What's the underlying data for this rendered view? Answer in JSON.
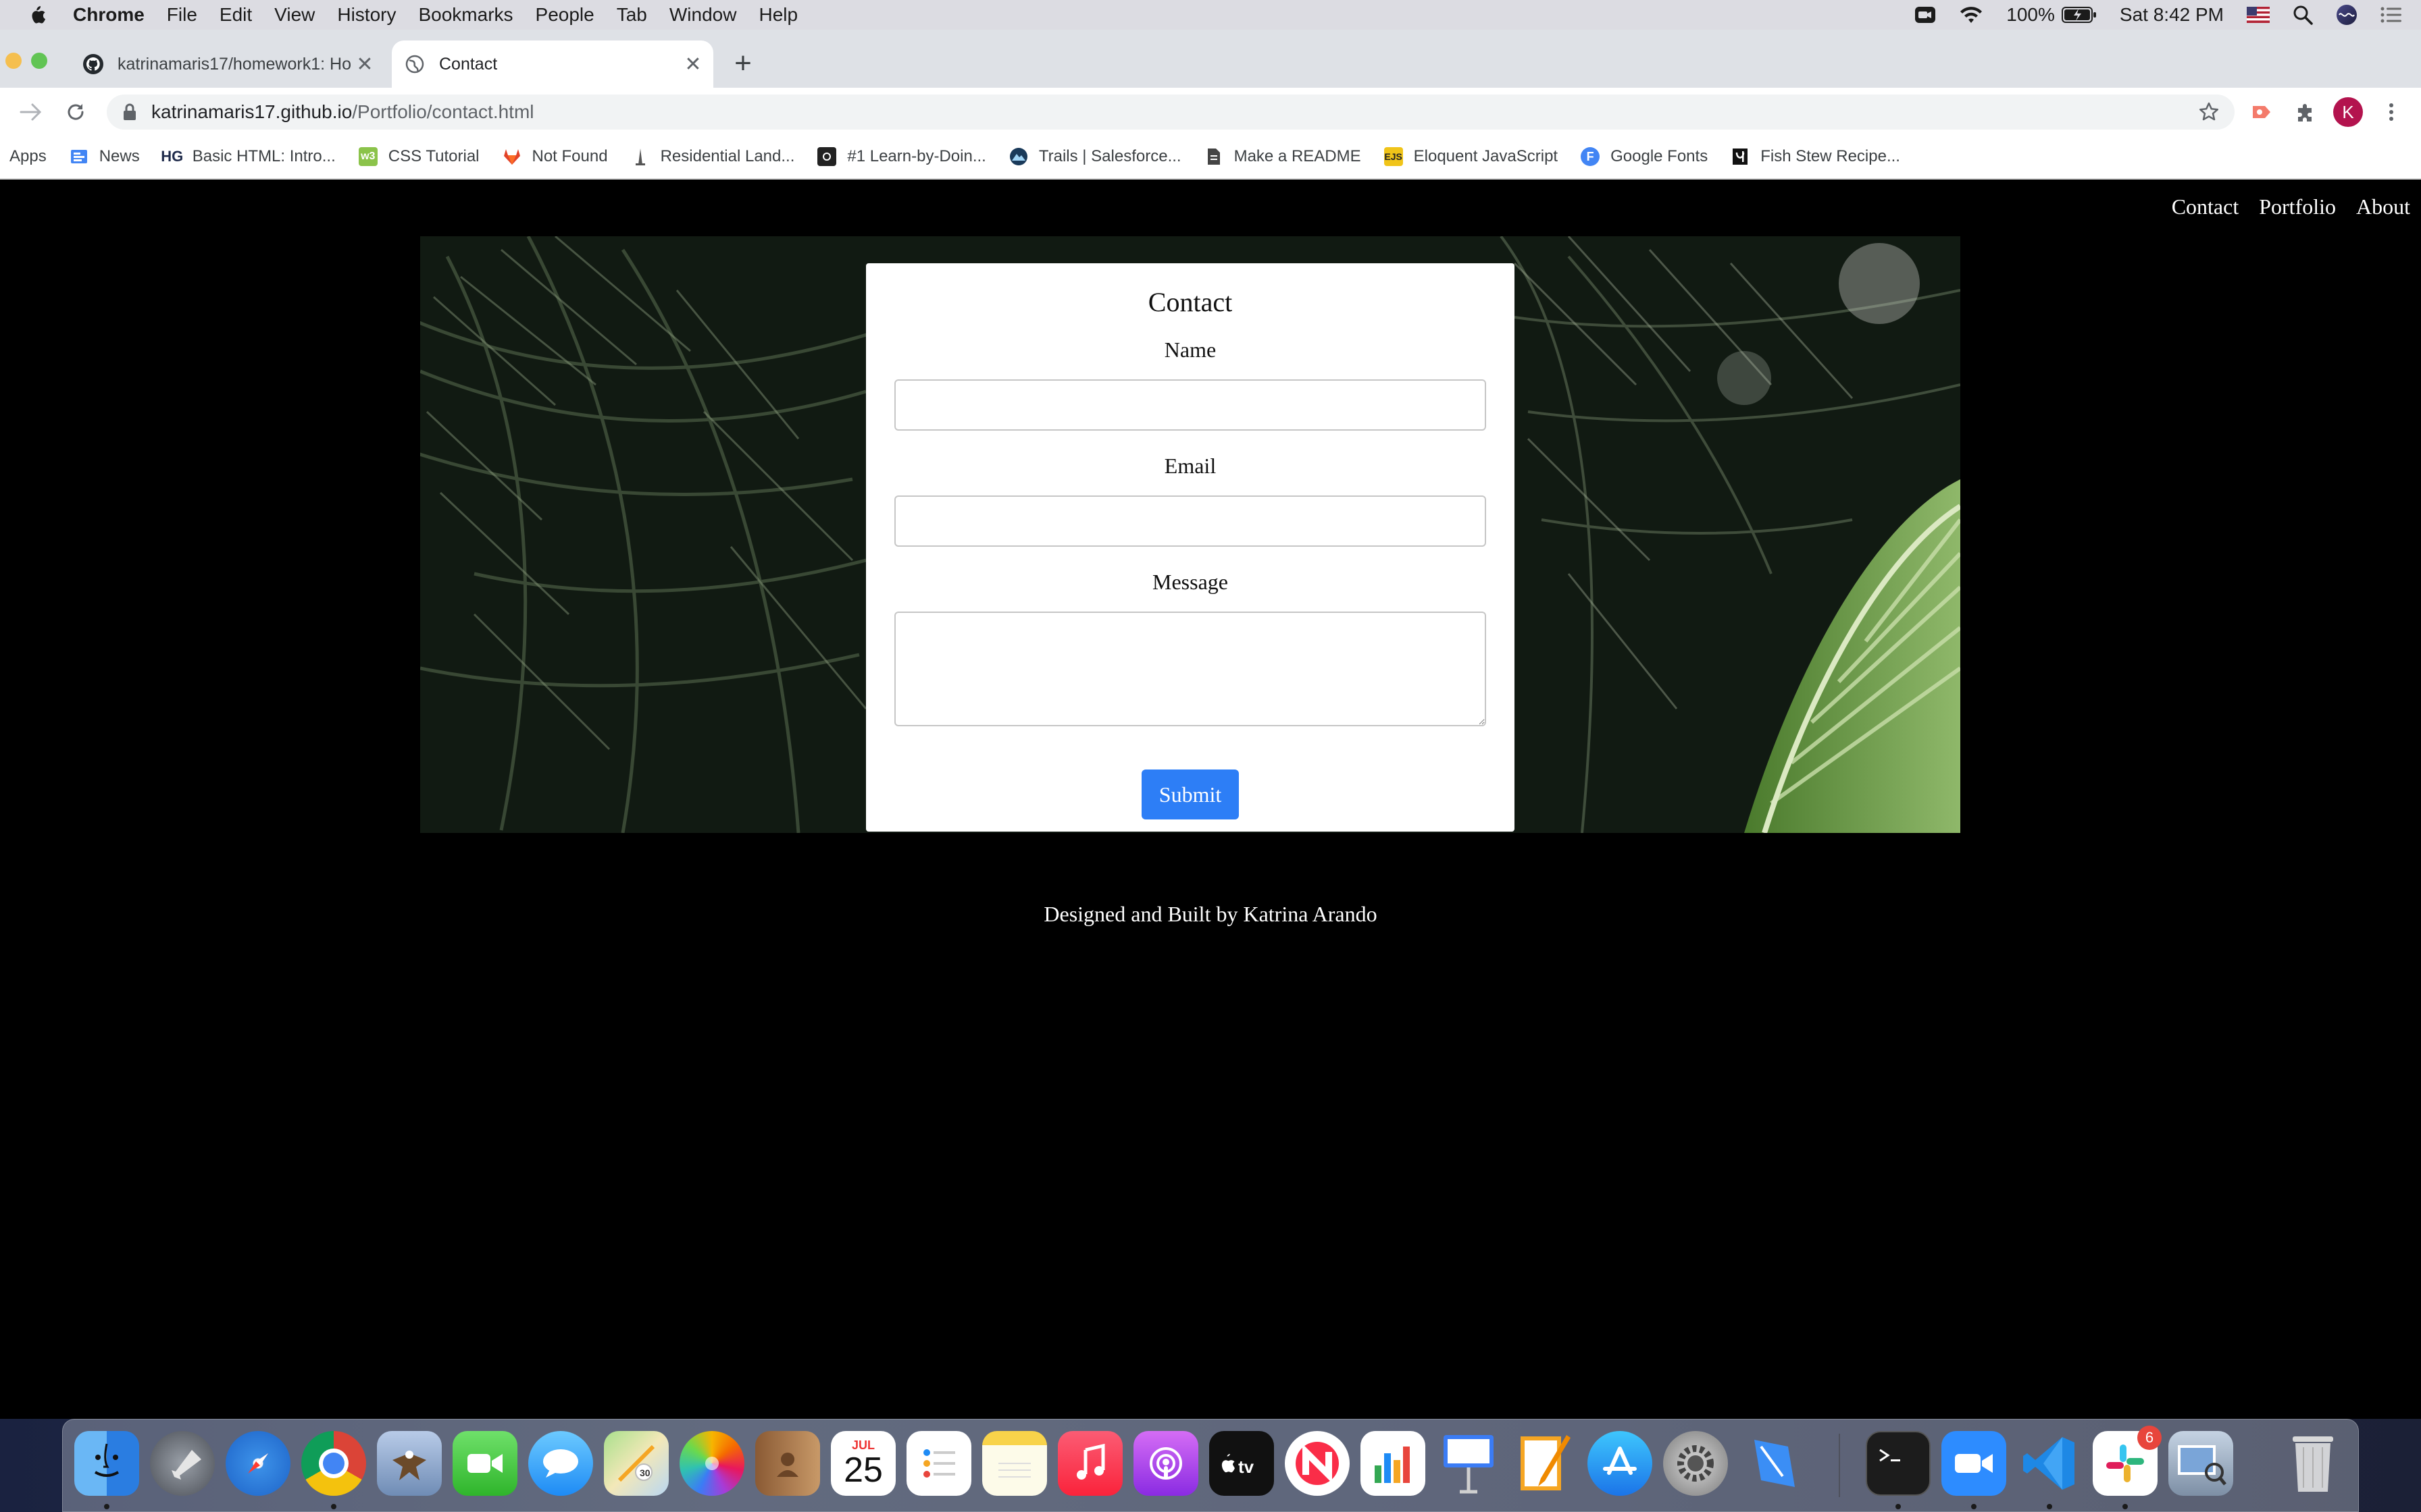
{
  "menubar": {
    "app": "Chrome",
    "items": [
      "File",
      "Edit",
      "View",
      "History",
      "Bookmarks",
      "People",
      "Tab",
      "Window",
      "Help"
    ],
    "battery": "100%",
    "clock": "Sat 8:42 PM"
  },
  "tabs": [
    {
      "title": "katrinamaris17/homework1: Ho",
      "icon": "github-icon"
    },
    {
      "title": "Contact",
      "icon": "globe-icon"
    }
  ],
  "address": {
    "host": "katrinamaris17.github.io",
    "path": "/Portfolio/contact.html"
  },
  "profile_initial": "K",
  "bookmarks": [
    {
      "label": "Apps",
      "icon": "apps-grid-icon"
    },
    {
      "label": "News",
      "icon": "google-news-icon"
    },
    {
      "label": "Basic HTML: Intro...",
      "icon": "hg-icon",
      "glyph": "HG"
    },
    {
      "label": "CSS Tutorial",
      "icon": "w3schools-icon",
      "glyph": "w3"
    },
    {
      "label": "Not Found",
      "icon": "gitlab-icon"
    },
    {
      "label": "Residential Land...",
      "icon": "tower-icon"
    },
    {
      "label": "#1 Learn-by-Doin...",
      "icon": "camera-icon"
    },
    {
      "label": "Trails | Salesforce...",
      "icon": "trailhead-icon"
    },
    {
      "label": "Make a README",
      "icon": "document-icon"
    },
    {
      "label": "Eloquent JavaScript",
      "icon": "ejs-icon",
      "glyph": "EJS"
    },
    {
      "label": "Google Fonts",
      "icon": "google-fonts-icon",
      "glyph": "F"
    },
    {
      "label": "Fish Stew Recipe...",
      "icon": "recipe-icon"
    }
  ],
  "site": {
    "nav": [
      "Contact",
      "Portfolio",
      "About"
    ],
    "form": {
      "title": "Contact",
      "name_label": "Name",
      "email_label": "Email",
      "message_label": "Message",
      "submit_label": "Submit"
    },
    "footer": "Designed and Built by Katrina Arando"
  },
  "dock": {
    "calendar_month": "JUL",
    "calendar_day": "25",
    "slack_badge": "6",
    "apps": [
      "finder-icon",
      "launchpad-icon",
      "safari-icon",
      "chrome-icon",
      "preview-eagle-icon",
      "facetime-icon",
      "messages-icon",
      "maps-icon",
      "photos-icon",
      "contacts-icon",
      "calendar-icon",
      "reminders-icon",
      "notes-icon",
      "music-icon",
      "podcasts-icon",
      "apple-tv-icon",
      "news-icon",
      "numbers-icon",
      "keynote-icon",
      "pages-icon",
      "app-store-icon",
      "system-preferences-icon",
      "xcode-icon",
      "terminal-icon",
      "zoom-icon",
      "vscode-icon",
      "slack-icon",
      "preview-icon",
      "trash-icon"
    ]
  }
}
